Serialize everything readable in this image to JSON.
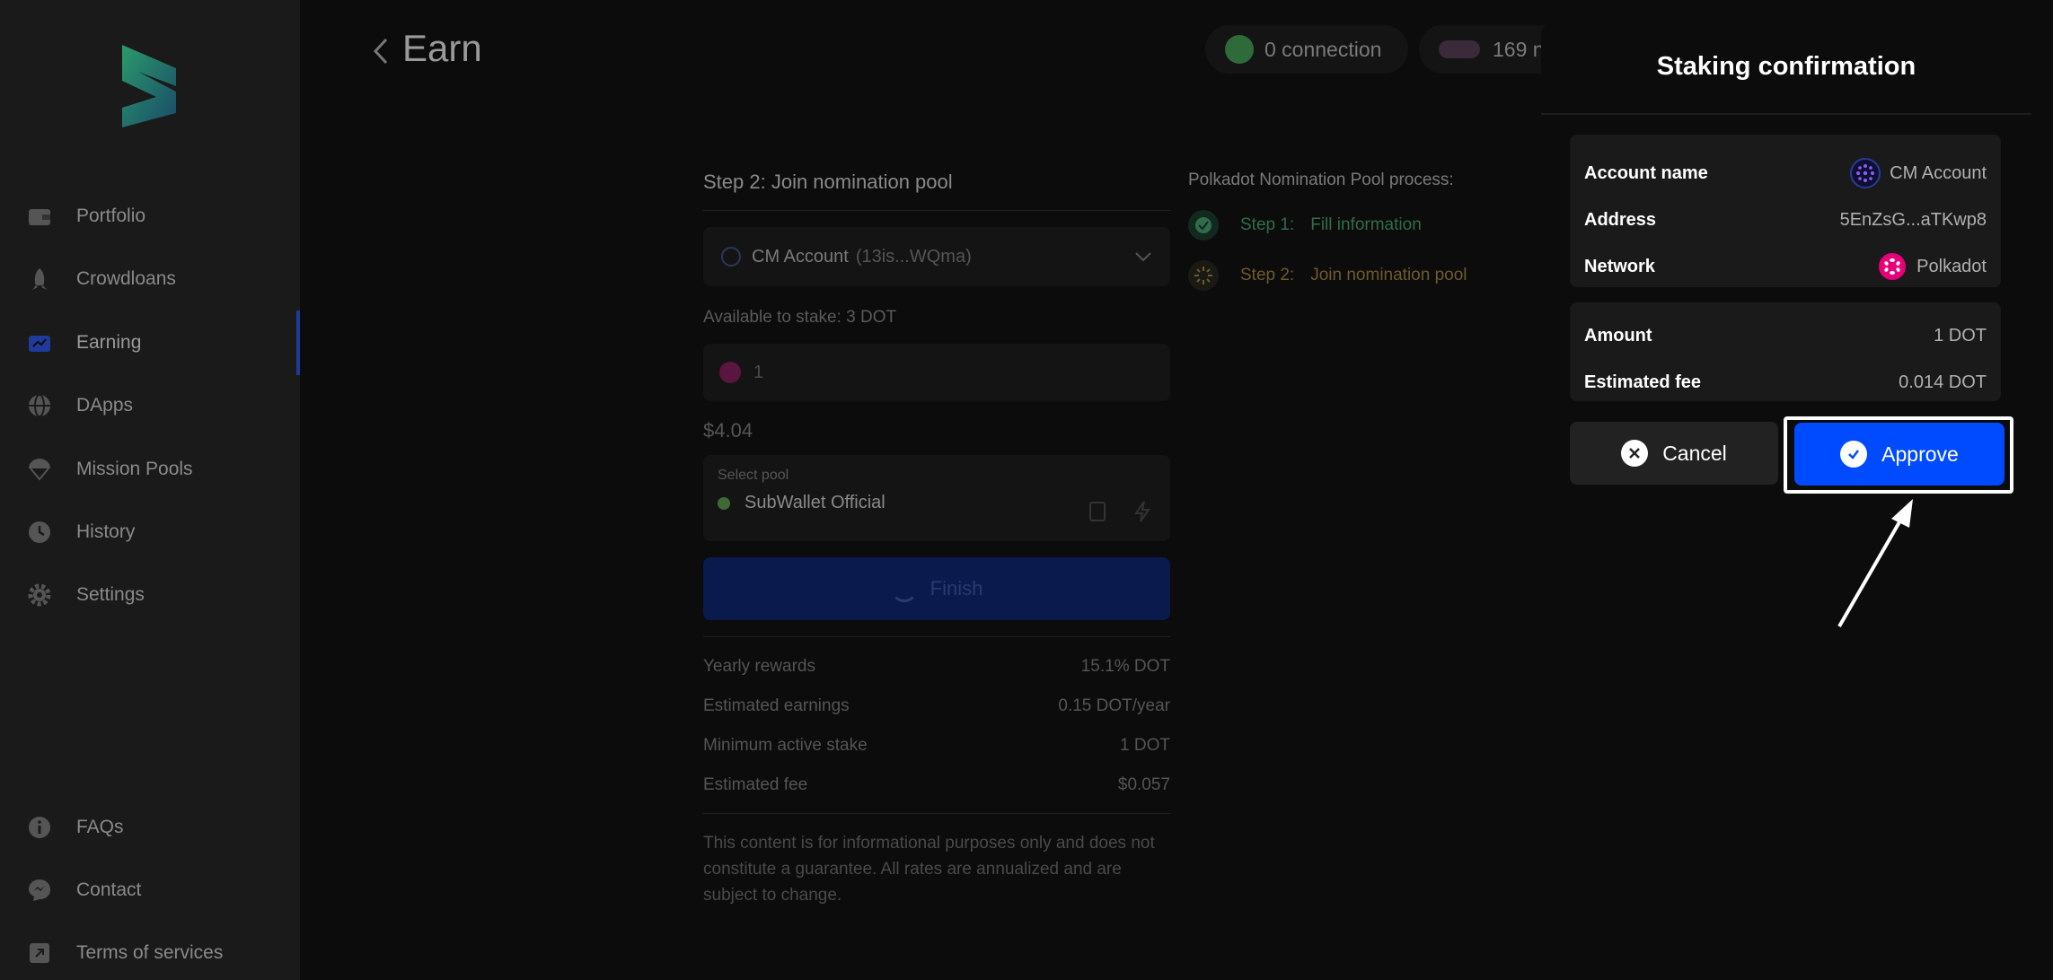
{
  "sidebar": {
    "items": [
      {
        "label": "Portfolio",
        "icon": "wallet-icon"
      },
      {
        "label": "Crowdloans",
        "icon": "rocket-icon"
      },
      {
        "label": "Earning",
        "icon": "earning-icon",
        "active": true
      },
      {
        "label": "DApps",
        "icon": "globe-icon"
      },
      {
        "label": "Mission Pools",
        "icon": "parachute-icon"
      },
      {
        "label": "History",
        "icon": "clock-icon"
      },
      {
        "label": "Settings",
        "icon": "gear-icon"
      }
    ],
    "bottom": [
      {
        "label": "FAQs",
        "icon": "info-icon"
      },
      {
        "label": "Contact",
        "icon": "messenger-icon"
      },
      {
        "label": "Terms of services",
        "icon": "external-link-icon"
      }
    ]
  },
  "header": {
    "title": "Earn",
    "connection": "0 connection",
    "networks": "169 n"
  },
  "form": {
    "step_title": "Step 2: Join nomination pool",
    "account_name": "CM Account",
    "account_addr": "(13is...WQma)",
    "available": "Available to stake: 3 DOT",
    "amount": "1",
    "usd_value": "$4.04",
    "pool_label": "Select pool",
    "pool_value": "SubWallet Official",
    "finish_label": "Finish",
    "info": [
      {
        "label": "Yearly rewards",
        "value": "15.1% DOT"
      },
      {
        "label": "Estimated earnings",
        "value": "0.15 DOT/year"
      },
      {
        "label": "Minimum active stake",
        "value": "1 DOT"
      },
      {
        "label": "Estimated fee",
        "value": "$0.057"
      }
    ],
    "disclaimer": "This content is for informational purposes only and does not constitute a guarantee. All rates are annualized and are subject to change."
  },
  "process": {
    "title": "Polkadot Nomination Pool process:",
    "steps": [
      {
        "num": "Step 1:",
        "label": "Fill information"
      },
      {
        "num": "Step 2:",
        "label": "Join nomination pool"
      }
    ]
  },
  "modal": {
    "title": "Staking confirmation",
    "account_name_label": "Account name",
    "account_name_value": "CM Account",
    "address_label": "Address",
    "address_value": "5EnZsG...aTKwp8",
    "network_label": "Network",
    "network_value": "Polkadot",
    "amount_label": "Amount",
    "amount_value": "1 DOT",
    "fee_label": "Estimated fee",
    "fee_value": "0.014 DOT",
    "cancel_label": "Cancel",
    "approve_label": "Approve"
  },
  "colors": {
    "accent": "#004bff",
    "polkadot": "#e6007a",
    "background": "#0c0c0c",
    "panel": "#1a1a1a"
  }
}
